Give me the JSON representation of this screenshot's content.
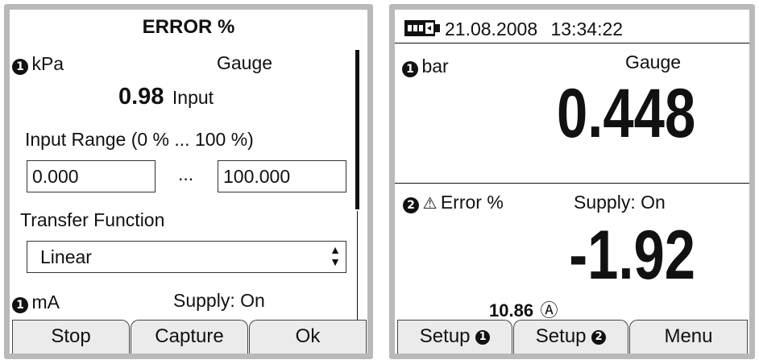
{
  "left": {
    "title": "ERROR %",
    "channel_badge": "1",
    "unit": "kPa",
    "pressure_type": "Gauge",
    "reading": "0.98",
    "reading_label": "Input",
    "input_range_label": "Input Range (0 % ... 100 %)",
    "range_low": "0.000",
    "range_separator": "...",
    "range_high": "100.000",
    "transfer_function_label": "Transfer Function",
    "transfer_function_value": "Linear",
    "output_channel_badge": "1",
    "output_unit": "mA",
    "supply_status": "Supply: On",
    "softkeys": [
      "Stop",
      "Capture",
      "Ok"
    ]
  },
  "right": {
    "date": "21.08.2008",
    "time": "13:34:22",
    "channel1_badge": "1",
    "channel1_unit": "bar",
    "channel1_type": "Gauge",
    "channel1_value": "0.448",
    "channel2_badge": "2",
    "channel2_warning": "⚠",
    "channel2_label": "Error %",
    "channel2_supply": "Supply: On",
    "channel2_value": "-1.92",
    "channel2_sub_value": "10.86",
    "channel2_sub_unit": "Ⓐ",
    "softkeys": [
      {
        "label": "Setup",
        "badge": "1"
      },
      {
        "label": "Setup",
        "badge": "2"
      },
      {
        "label": "Menu",
        "badge": ""
      }
    ]
  },
  "icons": {
    "battery": "battery-icon",
    "spinner": "updown-arrows-icon",
    "warning": "warning-triangle-icon"
  }
}
